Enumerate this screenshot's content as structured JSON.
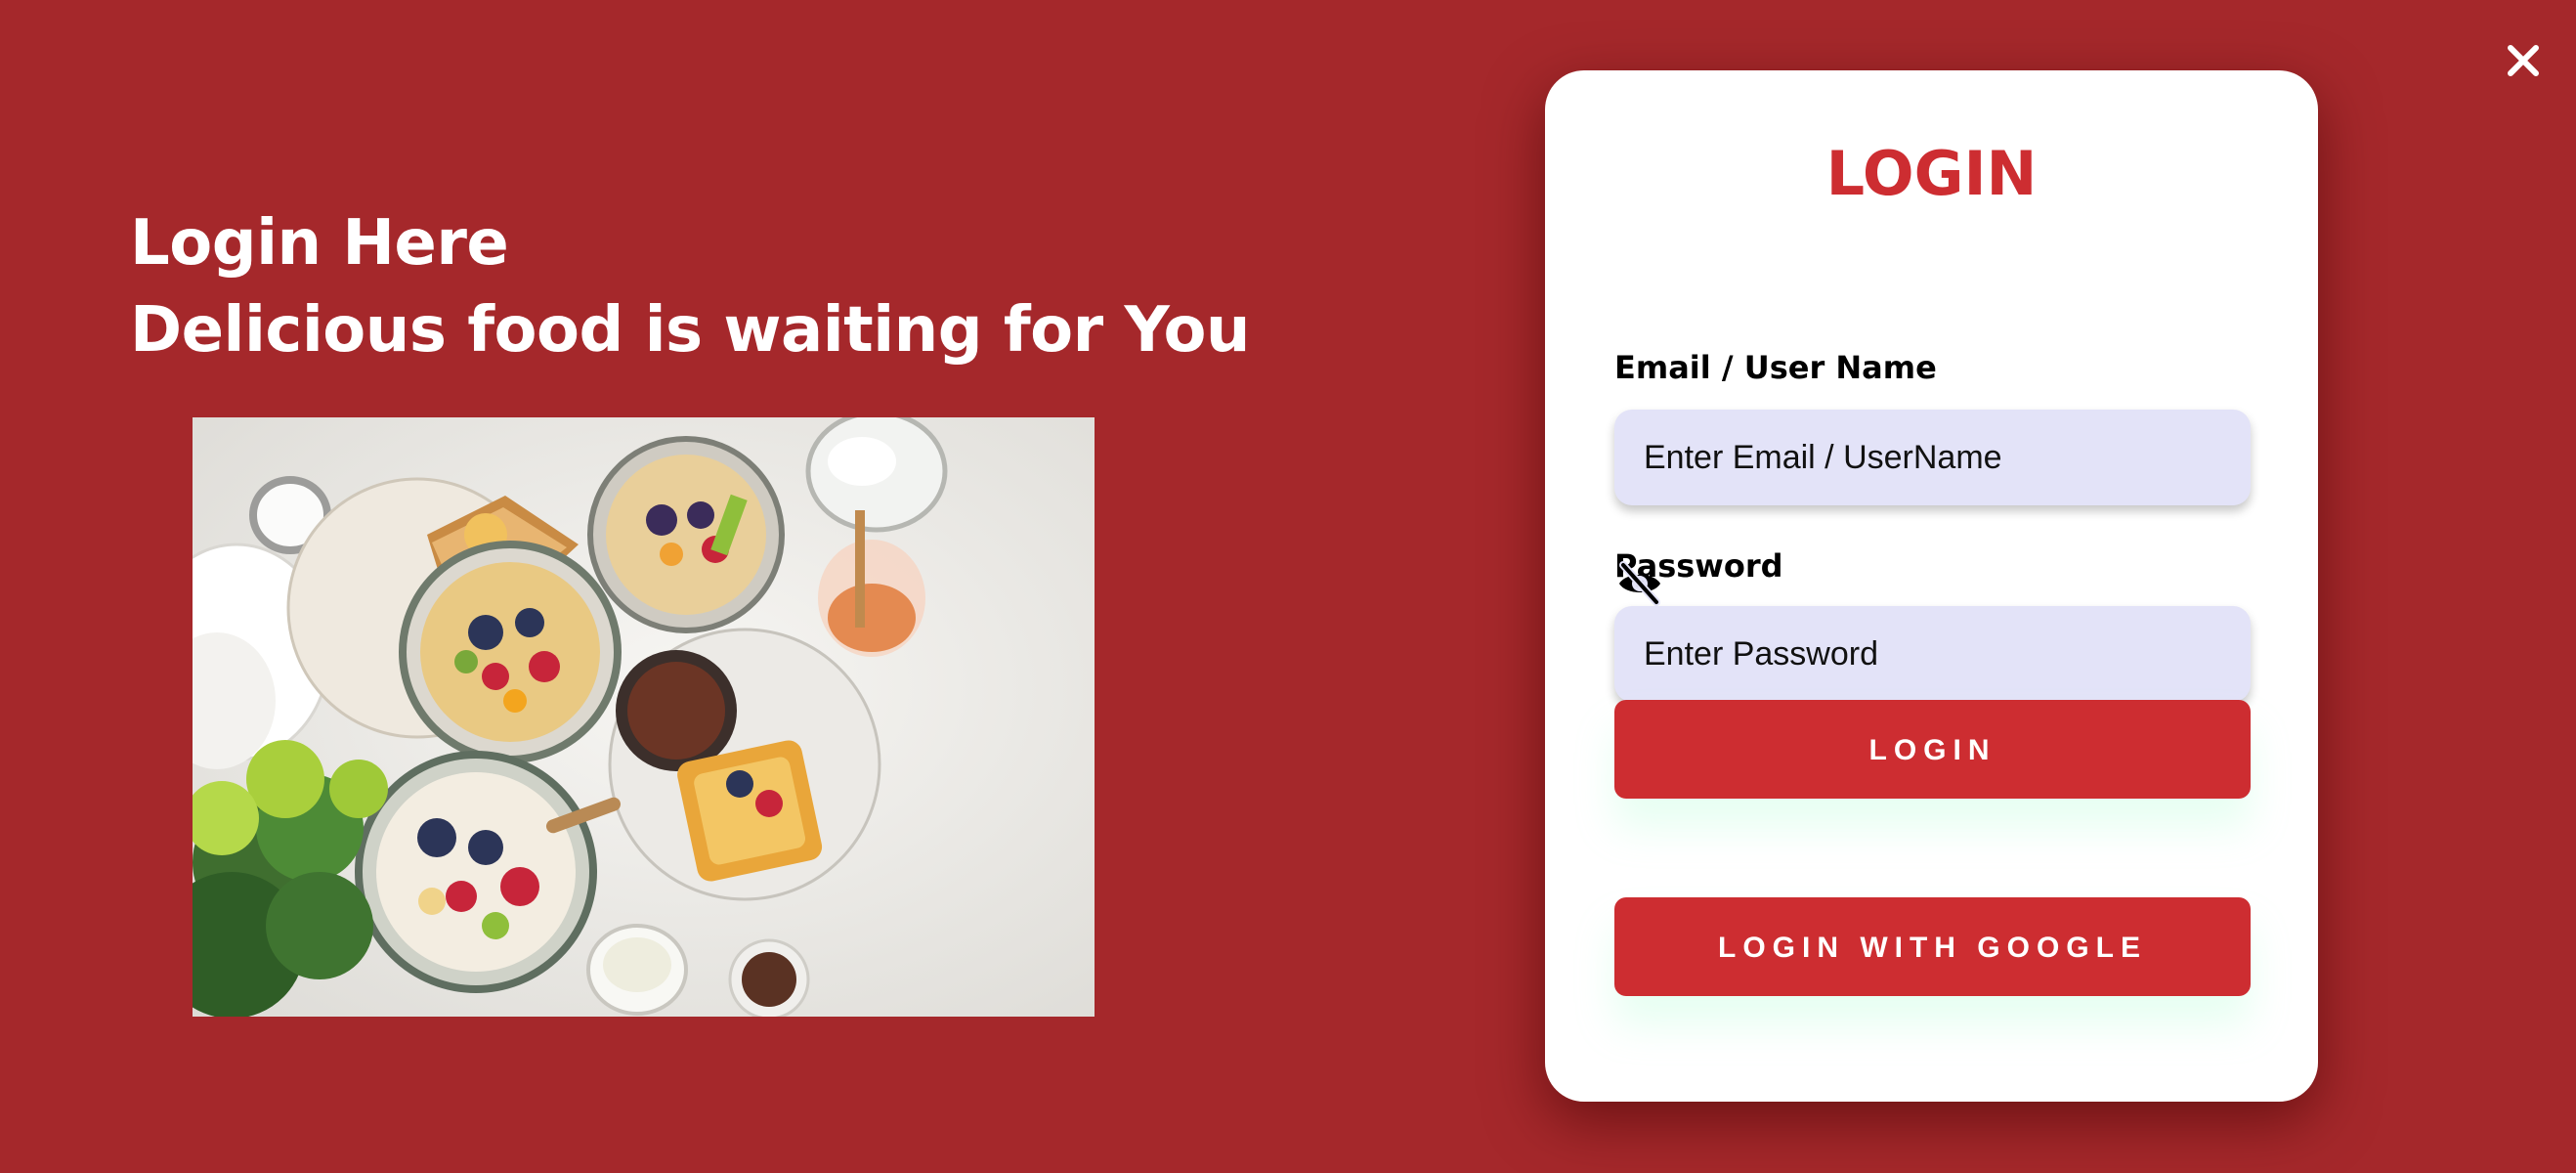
{
  "hero": {
    "line1": "Login Here",
    "line2": "Delicious food is waiting for You"
  },
  "icons": {
    "close": "close-icon",
    "password_visibility": "eye-off-icon"
  },
  "login_card": {
    "title": "LOGIN",
    "email_label": "Email / User Name",
    "email_placeholder": "Enter Email / UserName",
    "email_value": "",
    "password_label": "Password",
    "password_placeholder": "Enter Password",
    "password_value": "",
    "login_button": "LOGIN",
    "google_button": "LOGIN WITH GOOGLE"
  },
  "colors": {
    "background": "#a5282b",
    "accent": "#cd2d31",
    "input_background": "#e3e3f8",
    "card": "#ffffff"
  }
}
